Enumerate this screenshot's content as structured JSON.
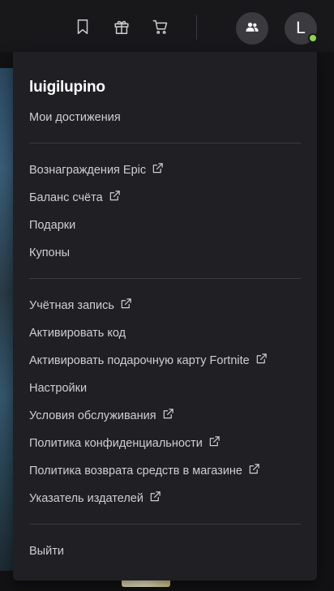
{
  "header": {
    "avatar_letter": "L",
    "icons": [
      "bookmark-icon",
      "gift-icon",
      "cart-icon",
      "friends-icon"
    ]
  },
  "menu": {
    "username": "luigilupino",
    "achievements": "Мои достижения",
    "group1": [
      {
        "label": "Вознаграждения Epic",
        "external": true
      },
      {
        "label": "Баланс счёта",
        "external": true
      },
      {
        "label": "Подарки",
        "external": false
      },
      {
        "label": "Купоны",
        "external": false
      }
    ],
    "group2": [
      {
        "label": "Учётная запись",
        "external": true
      },
      {
        "label": "Активировать код",
        "external": false
      },
      {
        "label": "Активировать подарочную карту Fortnite",
        "external": true
      },
      {
        "label": "Настройки",
        "external": false
      },
      {
        "label": "Условия обслуживания",
        "external": true
      },
      {
        "label": "Политика конфиденциальности",
        "external": true
      },
      {
        "label": "Политика возврата средств в магазине",
        "external": true
      },
      {
        "label": "Указатель издателей",
        "external": true
      }
    ],
    "signout": "Выйти"
  },
  "colors": {
    "menu_bg": "#202024",
    "online_status": "#8cd64f"
  }
}
